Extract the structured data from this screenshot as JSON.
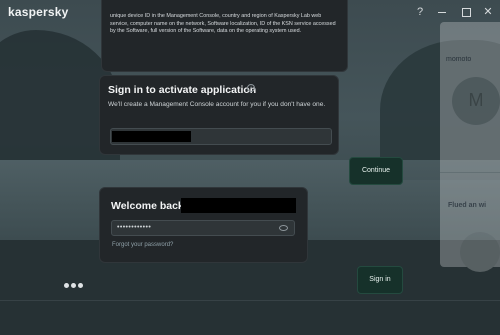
{
  "app": {
    "title": "kaspersky"
  },
  "window_controls": {
    "help": "?"
  },
  "consent": {
    "text": "unique device ID in the Management Console, country and region of Kaspersky Lab web service, computer name on the network, Software localization, ID of the KSN service accessed by the Software, full version of the Software, data on the operating system used."
  },
  "sign_in": {
    "title": "Sign in to activate application",
    "description": "We'll create a Management Console account for you if you don't have one.",
    "email_value": ""
  },
  "continue_button": {
    "label": "Continue"
  },
  "welcome": {
    "label": "Welcome back,",
    "password_mask": "••••••••••••",
    "forgot_link": "Forgot your password?"
  },
  "signin_button": {
    "label": "Sign in"
  },
  "side_card": {
    "name": "momoto",
    "avatar_letter": "M",
    "promo": "Flued an wi"
  },
  "colors": {
    "panel": "#222629",
    "button_bg": "#16312a",
    "text": "#e6e8ea"
  }
}
